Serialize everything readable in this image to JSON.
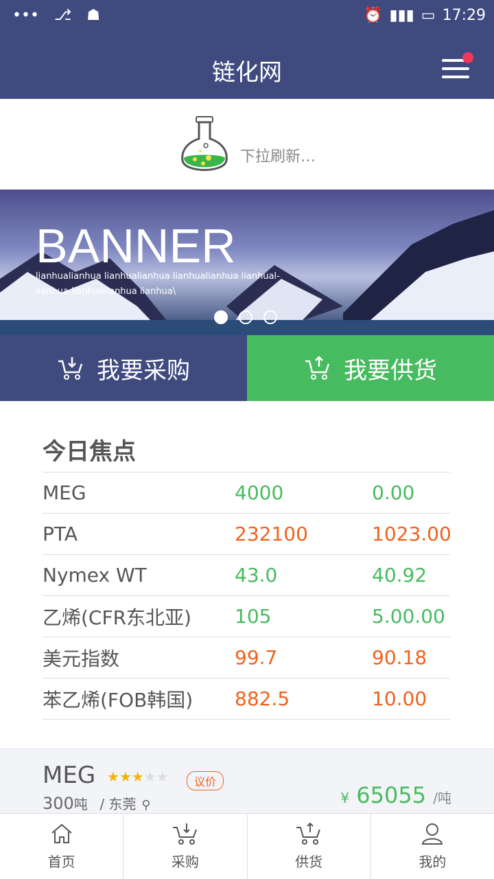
{
  "status": {
    "time": "17:29"
  },
  "nav": {
    "title": "链化网"
  },
  "refresh": {
    "text": "下拉刷新…"
  },
  "banner": {
    "title": "BANNER",
    "subtitle_line1": "lianhualianhua lianhualianhua lianhualianhua lianhual-",
    "subtitle_line2": "lianhua lianhualianhua lianhua\\"
  },
  "actions": {
    "buy": "我要采购",
    "supply": "我要供货"
  },
  "focus": {
    "title": "今日焦点",
    "rows": [
      {
        "name": "MEG",
        "v1": "4000",
        "v2": "0.00",
        "color": "green"
      },
      {
        "name": "PTA",
        "v1": "232100",
        "v2": "1023.00",
        "color": "orange"
      },
      {
        "name": "Nymex WT",
        "v1": "43.0",
        "v2": "40.92",
        "color": "green"
      },
      {
        "name": "乙烯(CFR东北亚)",
        "v1": "105",
        "v2": "5.00.00",
        "color": "green"
      },
      {
        "name": "美元指数",
        "v1": "99.7",
        "v2": "90.18",
        "color": "orange"
      },
      {
        "name": "苯乙烯(FOB韩国)",
        "v1": "882.5",
        "v2": "10.00",
        "color": "orange"
      }
    ]
  },
  "product": {
    "name": "MEG",
    "rating": 3,
    "tag": "议价",
    "qty": "300",
    "qty_unit": "吨",
    "location": "/ 东莞",
    "currency": "¥",
    "price": "65055",
    "price_unit": "/吨"
  },
  "tabs": [
    "首页",
    "采购",
    "供货",
    "我的"
  ],
  "colors": {
    "primary": "#3f4a7f",
    "green": "#47bb5f",
    "orange": "#f0611c"
  }
}
